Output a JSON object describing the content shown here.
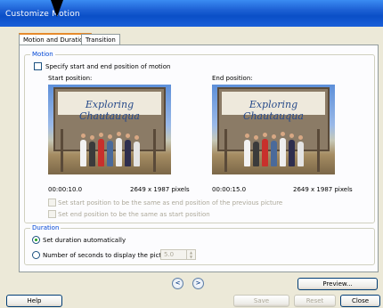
{
  "window": {
    "title": "Customize Motion"
  },
  "tabs": [
    {
      "label": "Motion and Duration",
      "active": true
    },
    {
      "label": "Transition",
      "active": false
    }
  ],
  "motion": {
    "group_label": "Motion",
    "specify_checkbox_label": "Specify start and end position of motion",
    "specify_checked": false,
    "start": {
      "label": "Start position:",
      "time": "00:00:10.0",
      "size": "2649 x 1987 pixels",
      "photo_caption": "Exploring Chautauqua"
    },
    "end": {
      "label": "End position:",
      "time": "00:00:15.0",
      "size": "2649 x 1987 pixels",
      "photo_caption": "Exploring Chautauqua"
    },
    "option_start_same_as_prev_end": "Set start position to be the same as end position of the previous picture",
    "option_end_same_as_start": "Set end position to be the same as start position"
  },
  "duration": {
    "group_label": "Duration",
    "auto_label": "Set duration automatically",
    "auto_selected": true,
    "seconds_label": "Number of seconds to display the picture",
    "seconds_value": "5.0"
  },
  "nav": {
    "prev_icon": "left-arrow-circle-icon",
    "next_icon": "right-arrow-circle-icon"
  },
  "buttons": {
    "preview": "Preview...",
    "help": "Help",
    "save": "Save",
    "reset": "Reset",
    "close": "Close"
  },
  "colors": {
    "titlebar": "#0a4fc7",
    "group_label": "#0046d5",
    "tab_highlight": "#e68b2c",
    "radio_dot": "#21a121"
  }
}
